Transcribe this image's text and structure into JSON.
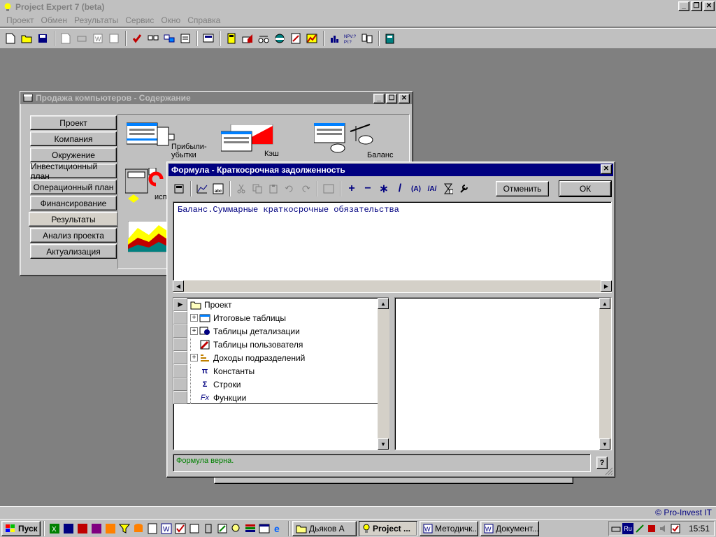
{
  "app": {
    "title": "Project Expert 7 (beta)",
    "menu": [
      "Проект",
      "Обмен",
      "Результаты",
      "Сервис",
      "Окно",
      "Справка"
    ]
  },
  "content_window": {
    "title": "Продажа компьютеров - Содержание",
    "nav": [
      "Проект",
      "Компания",
      "Окружение",
      "Инвестиционный план",
      "Операционный план",
      "Финансирование",
      "Результаты",
      "Анализ проекта",
      "Актуализация"
    ],
    "selected_nav": "Результаты",
    "icons": {
      "profit_loss_line1": "Прибыли-",
      "profit_loss_line2": "убытки",
      "cash_flow": "Кэш - фло",
      "balance": "Баланс",
      "usage": "исп"
    }
  },
  "formula_dialog": {
    "title": "Формула - Краткосрочная задолженность",
    "cancel_label": "Отменить",
    "ok_label": "ОК",
    "formula": "Баланс.Суммарные краткосрочные обязательства",
    "tree": [
      {
        "label": "Проект",
        "expandable": false,
        "current": true
      },
      {
        "label": "Итоговые таблицы",
        "expandable": true
      },
      {
        "label": "Таблицы детализации",
        "expandable": true
      },
      {
        "label": "Таблицы пользователя",
        "expandable": false
      },
      {
        "label": "Доходы подразделений",
        "expandable": true
      },
      {
        "label": "Константы",
        "expandable": false
      },
      {
        "label": "Строки",
        "expandable": false
      },
      {
        "label": "Функции",
        "expandable": false
      }
    ],
    "status": "Формула верна."
  },
  "copyright": "© Pro-Invest IT",
  "taskbar": {
    "start_label": "Пуск",
    "tasks": [
      "Дьяков А",
      "Project ...",
      "Методичк...",
      "Документ..."
    ],
    "active_task": "Project ...",
    "tray_lang": "Ru",
    "clock": "15:51"
  }
}
